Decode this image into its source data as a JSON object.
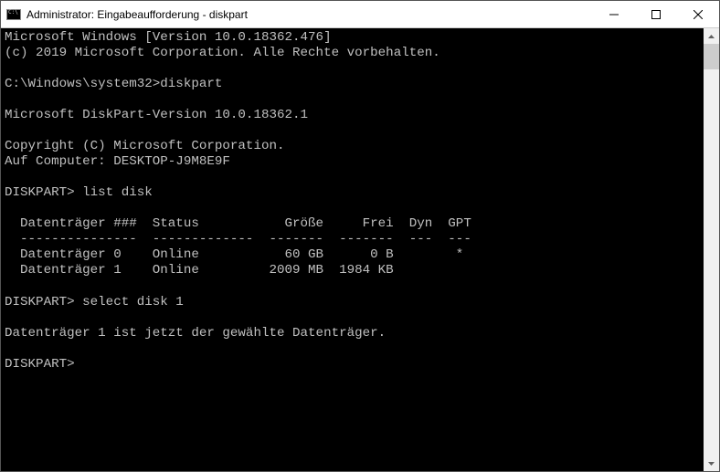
{
  "window": {
    "title": "Administrator: Eingabeaufforderung - diskpart"
  },
  "terminal": {
    "header_line_1": "Microsoft Windows [Version 10.0.18362.476]",
    "header_line_2": "(c) 2019 Microsoft Corporation. Alle Rechte vorbehalten.",
    "prompt_initial": "C:\\Windows\\system32>",
    "cmd_initial": "diskpart",
    "diskpart_version": "Microsoft DiskPart-Version 10.0.18362.1",
    "copyright": "Copyright (C) Microsoft Corporation.",
    "computer_line": "Auf Computer: DESKTOP-J9M8E9F",
    "prompt_dp": "DISKPART>",
    "cmd_listdisk": "list disk",
    "table": {
      "headers": {
        "disk": "Datenträger ###",
        "status": "Status",
        "size": "Größe",
        "free": "Frei",
        "dyn": "Dyn",
        "gpt": "GPT"
      },
      "sep": {
        "disk": "---------------",
        "status": "-------------",
        "size": "-------",
        "free": "-------",
        "dyn": "---",
        "gpt": "---"
      },
      "rows": [
        {
          "disk": "Datenträger 0",
          "status": "Online",
          "size": "60 GB",
          "free": "0 B",
          "dyn": "",
          "gpt": "*"
        },
        {
          "disk": "Datenträger 1",
          "status": "Online",
          "size": "2009 MB",
          "free": "1984 KB",
          "dyn": "",
          "gpt": ""
        }
      ]
    },
    "cmd_select": "select disk 1",
    "select_response": "Datenträger 1 ist jetzt der gewählte Datenträger."
  }
}
